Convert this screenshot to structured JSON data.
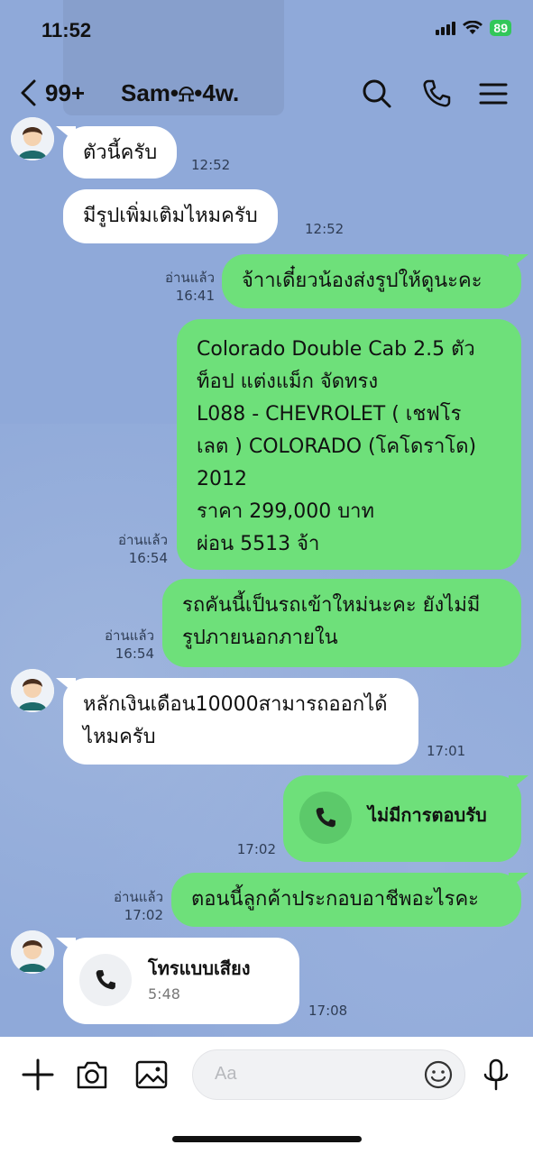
{
  "status": {
    "time": "11:52",
    "battery": "89"
  },
  "header": {
    "unread": "99+",
    "name": "Sam•⍾•4w."
  },
  "messages": [
    {
      "text": "ตัวนี้ครับ",
      "time": "12:52"
    },
    {
      "text": "มีรูปเพิ่มเติมไหมครับ",
      "time": "12:52"
    },
    {
      "text": "จ้าาเดี๋ยวน้องส่งรูปให้ดูนะคะ",
      "read": "อ่านแล้ว",
      "time": "16:41"
    },
    {
      "lines": [
        "Colorado Double Cab 2.5 ตัว",
        "ท็อป แต่งแม็ก จัดทรง",
        "L088 - CHEVROLET ( เชฟโร",
        "เลต ) COLORADO (โคโดราโด)",
        "2012",
        "ราคา 299,000 บาท",
        "ผ่อน 5513 จ้า"
      ],
      "read": "อ่านแล้ว",
      "time": "16:54"
    },
    {
      "lines": [
        "รถคันนี้เป็นรถเข้าใหม่นะคะ ยังไม่มี",
        "รูปภายนอกภายใน"
      ],
      "read": "อ่านแล้ว",
      "time": "16:54"
    },
    {
      "lines": [
        "หลักเงินเดือน10000สามารถออกได้",
        "ไหมครับ"
      ],
      "time": "17:01"
    },
    {
      "text": "ไม่มีการตอบรับ",
      "time": "17:02",
      "icon": "phone-icon"
    },
    {
      "text": "ตอนนี้ลูกค้าประกอบอาชีพอะไรคะ",
      "read": "อ่านแล้ว",
      "time": "17:02"
    },
    {
      "title": "โทรแบบเสียง",
      "duration": "5:48",
      "time": "17:08",
      "icon": "phone-icon"
    }
  ],
  "composer": {
    "placeholder": "Aa"
  },
  "colors": {
    "background": "#8fa9d9",
    "outgoing": "#6ee07a",
    "incoming": "#ffffff"
  }
}
